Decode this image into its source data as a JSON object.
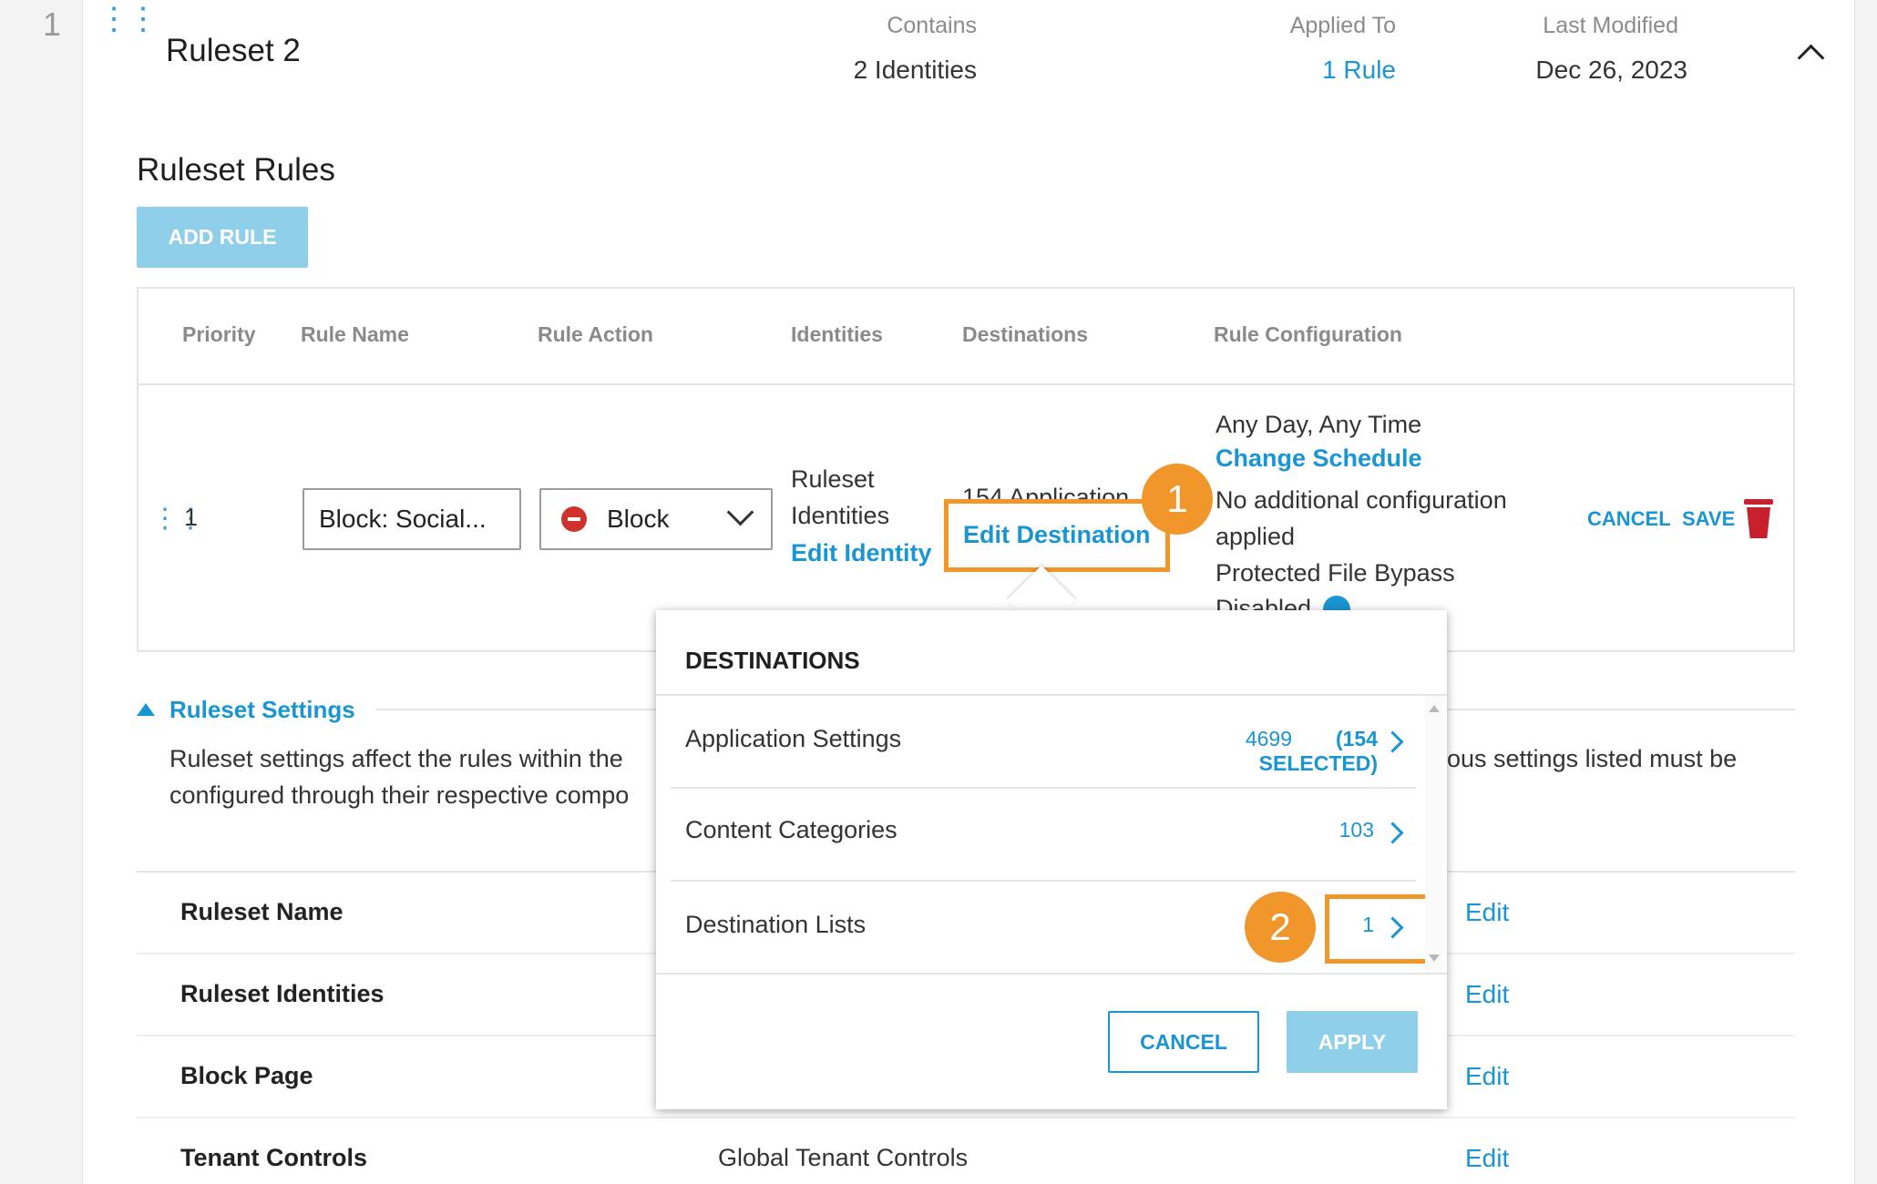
{
  "ruleset": {
    "row_number": "1",
    "title": "Ruleset 2",
    "contains_label": "Contains",
    "contains_value": "2 Identities",
    "applied_label": "Applied To",
    "applied_value": "1 Rule",
    "modified_label": "Last Modified",
    "modified_value": "Dec 26, 2023"
  },
  "rules": {
    "heading": "Ruleset Rules",
    "add_button": "ADD RULE",
    "columns": [
      "Priority",
      "Rule Name",
      "Rule Action",
      "Identities",
      "Destinations",
      "Rule Configuration"
    ],
    "row": {
      "priority": "1",
      "rule_name": "Block: Social...",
      "action": "Block",
      "identities_line1": "Ruleset",
      "identities_line2": "Identities",
      "edit_identity": "Edit Identity",
      "destinations_text": "154 Application",
      "edit_destination": "Edit Destination",
      "config_schedule": "Any Day, Any Time",
      "change_schedule": "Change Schedule",
      "config_line2": "No additional configuration",
      "config_line3": "applied",
      "config_line4": "Protected File Bypass",
      "config_line5": "Disabled",
      "cancel": "CANCEL",
      "save": "SAVE"
    }
  },
  "settings": {
    "heading": "Ruleset Settings",
    "desc_line1_left": "Ruleset settings affect the rules within the",
    "desc_line1_right": "ous settings listed must be",
    "desc_line2": "configured through their respective compo",
    "rows": [
      {
        "label": "Ruleset Name",
        "value": "",
        "edit": "Edit"
      },
      {
        "label": "Ruleset Identities",
        "value": "",
        "edit": "Edit"
      },
      {
        "label": "Block Page",
        "value": "",
        "edit": "Edit"
      },
      {
        "label": "Tenant Controls",
        "value": "Global Tenant Controls",
        "edit": "Edit"
      }
    ]
  },
  "destinations_popup": {
    "title": "DESTINATIONS",
    "items": [
      {
        "label": "Application Settings",
        "count": "4699",
        "selected": "(154 SELECTED)"
      },
      {
        "label": "Content Categories",
        "count": "103"
      },
      {
        "label": "Destination Lists",
        "count": "1"
      }
    ],
    "cancel": "CANCEL",
    "apply": "APPLY"
  },
  "callouts": [
    "1",
    "2"
  ],
  "colors": {
    "accent": "#1a95d3",
    "callout": "#f0962a",
    "block_icon": "#d0312d",
    "trash": "#c8202c"
  }
}
